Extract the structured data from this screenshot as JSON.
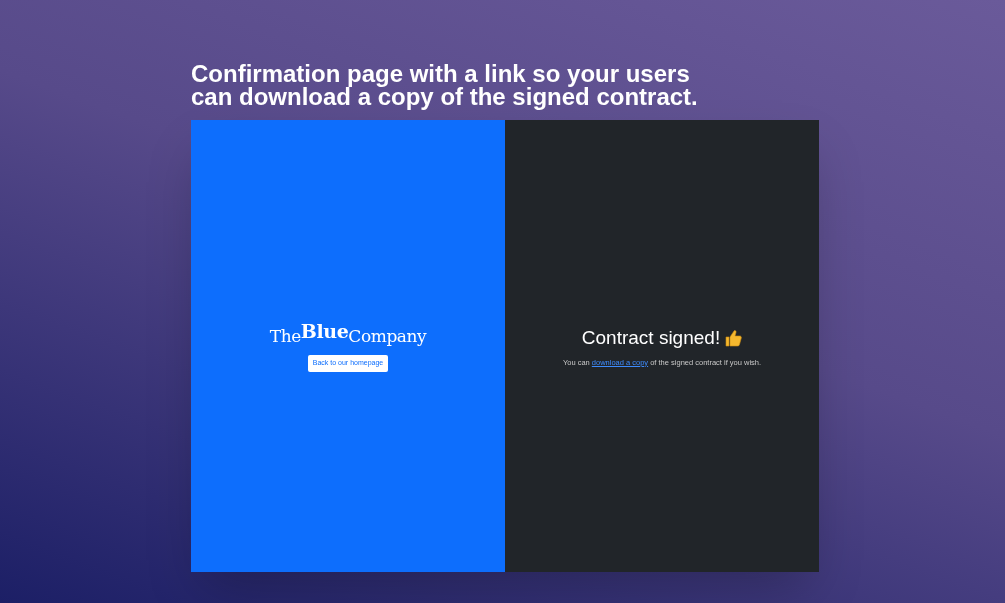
{
  "headline": [
    "Confirmation page with a link so your users",
    "can download a copy of the signed contract."
  ],
  "left_panel": {
    "logo": [
      "The",
      "Blue",
      "Company"
    ],
    "button": "Back to our homepage"
  },
  "right_panel": {
    "title": "Contract signed!",
    "message": {
      "before": "You can ",
      "link": "download a copy",
      "after": " of the signed contract if you wish."
    }
  }
}
